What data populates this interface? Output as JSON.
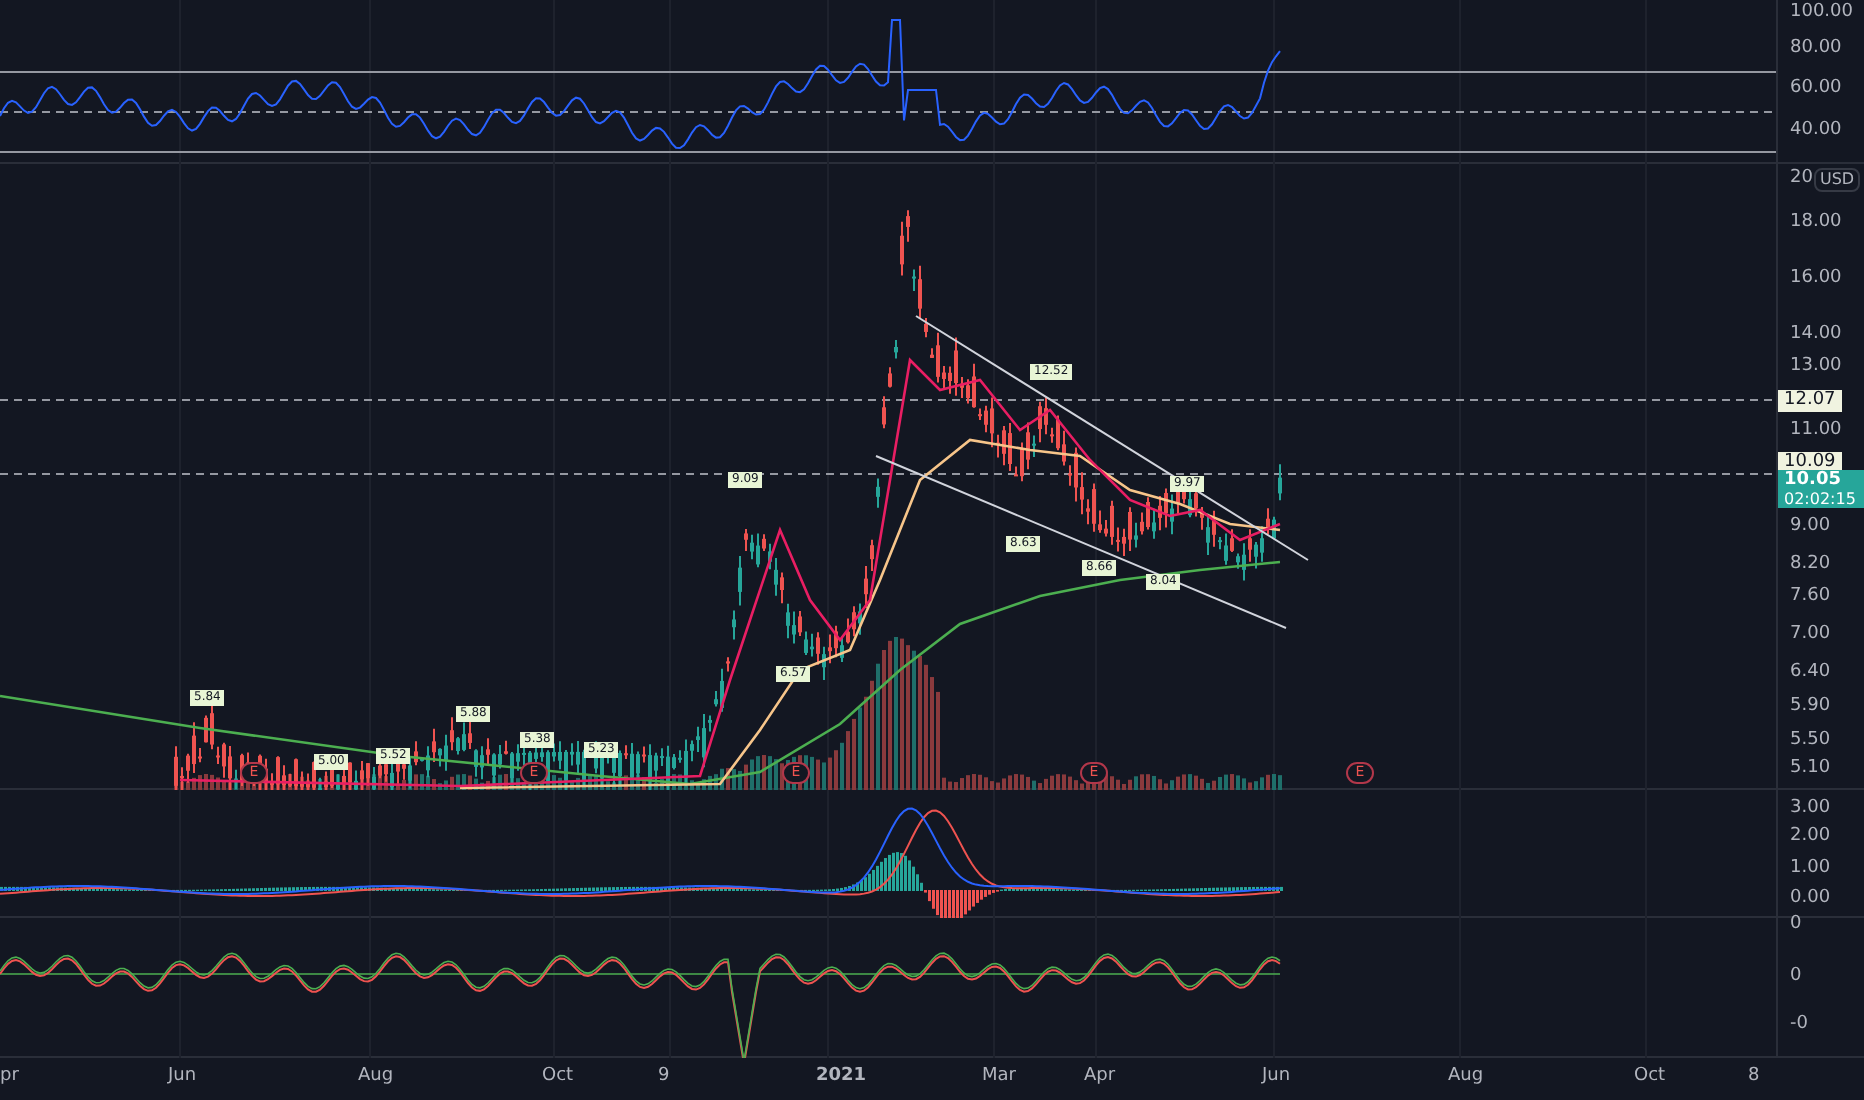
{
  "rsi_panel": {
    "axis_labels": [
      "100.00",
      "80.00",
      "60.00",
      "40.00"
    ]
  },
  "price_panel": {
    "currency": "USD",
    "axis_labels": [
      "20",
      "18.00",
      "16.00",
      "14.00",
      "13.00",
      "11.00",
      "9.00",
      "8.20",
      "7.60",
      "7.00",
      "6.40",
      "5.90",
      "5.50",
      "5.10"
    ],
    "price_tags": [
      {
        "kind": "level",
        "text": "12.07"
      },
      {
        "kind": "level",
        "text": "10.09"
      },
      {
        "kind": "last",
        "text": "10.05",
        "countdown": "02:02:15"
      }
    ],
    "point_labels": [
      "5.84",
      "5.00",
      "5.52",
      "5.88",
      "5.38",
      "5.23",
      "9.09",
      "6.57",
      "12.52",
      "8.63",
      "8.66",
      "9.97",
      "8.04"
    ],
    "earnings_markers": [
      "E",
      "E",
      "E",
      "E",
      "E"
    ]
  },
  "macd_panel": {
    "axis_labels": [
      "3.00",
      "2.00",
      "1.00",
      "0.00"
    ]
  },
  "oscillator_panel": {
    "axis_labels": [
      "0",
      "0",
      "-0"
    ]
  },
  "time_axis": {
    "labels": [
      {
        "text": "pr",
        "bold": false
      },
      {
        "text": "Jun",
        "bold": false
      },
      {
        "text": "Aug",
        "bold": false
      },
      {
        "text": "Oct",
        "bold": false
      },
      {
        "text": "9",
        "bold": false
      },
      {
        "text": "2021",
        "bold": true
      },
      {
        "text": "Mar",
        "bold": false
      },
      {
        "text": "Apr",
        "bold": false
      },
      {
        "text": "Jun",
        "bold": false
      },
      {
        "text": "Aug",
        "bold": false
      },
      {
        "text": "Oct",
        "bold": false
      },
      {
        "text": "8",
        "bold": false
      }
    ]
  }
}
